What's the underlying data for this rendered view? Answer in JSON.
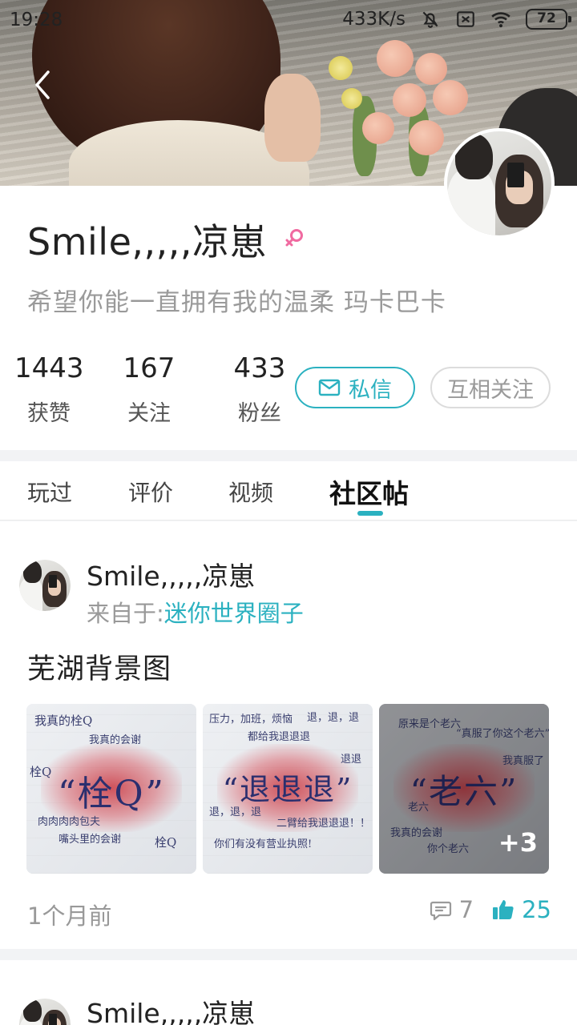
{
  "status_bar": {
    "time": "19:28",
    "speed": "433K/s",
    "battery": "72"
  },
  "profile": {
    "username": "Smile,,,,,凉崽",
    "signature": "希望你能一直拥有我的温柔 玛卡巴卡",
    "stats": [
      {
        "value": "1443",
        "label": "获赞"
      },
      {
        "value": "167",
        "label": "关注"
      },
      {
        "value": "433",
        "label": "粉丝"
      }
    ],
    "message_button": "私信",
    "follow_button": "互相关注"
  },
  "tabs": [
    {
      "label": "玩过",
      "active": false
    },
    {
      "label": "评价",
      "active": false
    },
    {
      "label": "视频",
      "active": false
    },
    {
      "label": "社区帖",
      "active": true
    }
  ],
  "post": {
    "author": "Smile,,,,,凉崽",
    "source_prefix": "来自于:",
    "source_circle": "迷你世界圈子",
    "title": "芜湖背景图",
    "images": [
      {
        "big_text": "“栓Q”",
        "lines": [
          "我真的栓Q",
          "我真的会谢",
          "栓Q",
          "肉肉肉肉包夫",
          "嘴头里的会谢",
          "栓Q"
        ]
      },
      {
        "big_text": "“退退退”",
        "lines": [
          "压力，加班，烦恼",
          "退，退，退",
          "都给我退退退",
          "退退",
          "退，退，退",
          "二臂给我退退退！！",
          "你们有没有营业执照!"
        ]
      },
      {
        "big_text": "“老六”",
        "lines": [
          "原来是个老六",
          "“真服了你这个老六”",
          "我真服了",
          "老六",
          "我真的会谢",
          "你个老六"
        ]
      }
    ],
    "more_count": "+3",
    "time": "1个月前",
    "comments": "7",
    "likes": "25"
  },
  "post2": {
    "author": "Smile,,,,,凉崽"
  },
  "colors": {
    "accent": "#2bb1c0",
    "gender": "#f06aa0"
  },
  "icons": [
    "back-arrow-icon",
    "female-icon",
    "mail-icon",
    "comment-icon",
    "thumbs-up-icon",
    "bell-off-icon",
    "wifi-icon",
    "battery-icon"
  ]
}
